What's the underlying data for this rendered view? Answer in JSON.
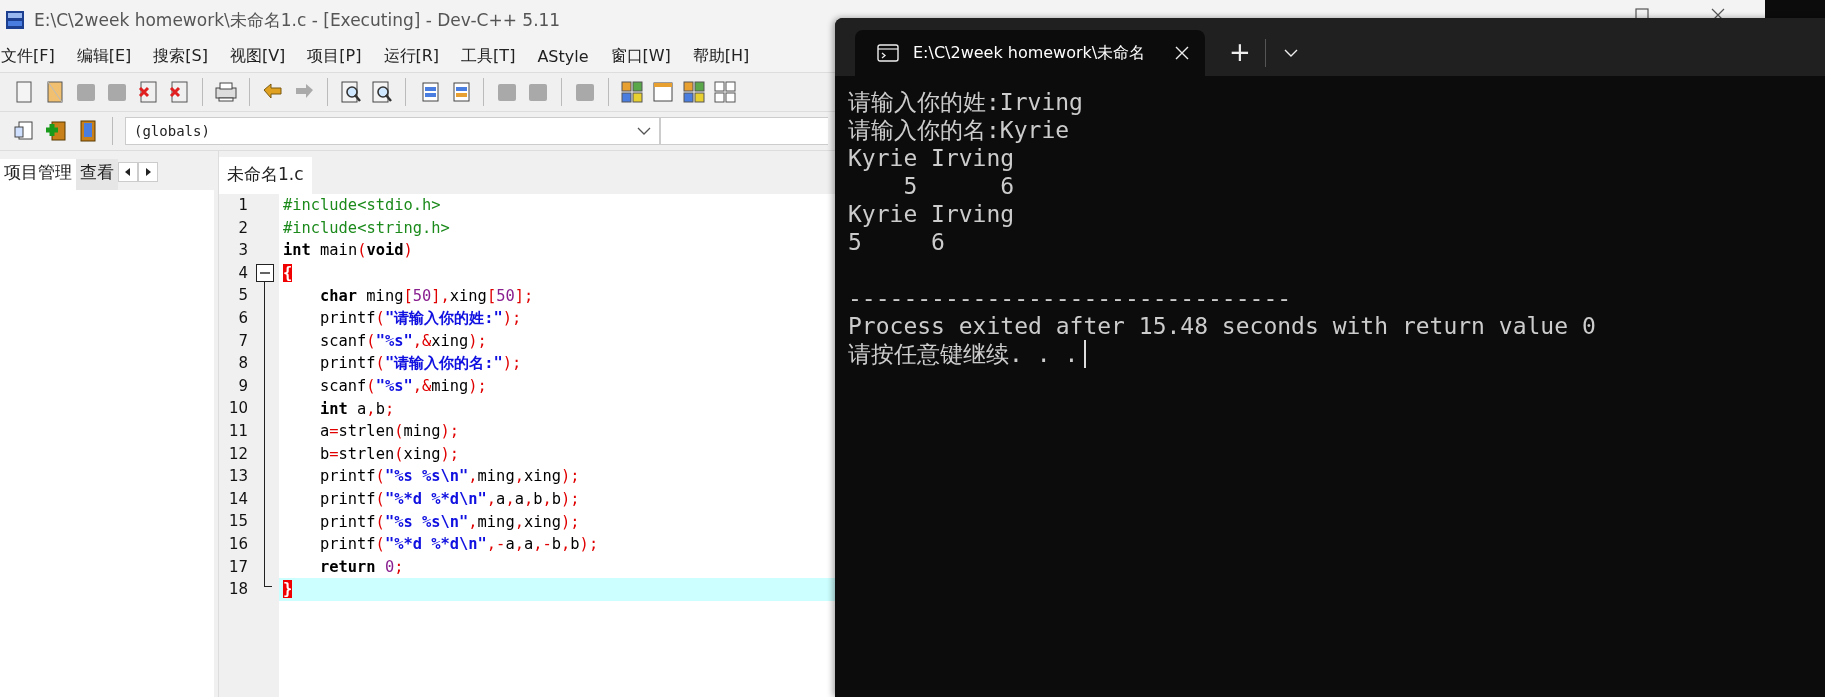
{
  "ide": {
    "title": "E:\\C\\2week homework\\未命名1.c - [Executing] - Dev-C++ 5.11",
    "menu": [
      "文件[F]",
      "编辑[E]",
      "搜索[S]",
      "视图[V]",
      "项目[P]",
      "运行[R]",
      "工具[T]",
      "AStyle",
      "窗口[W]",
      "帮助[H]"
    ],
    "scope_combo": {
      "value": "(globals)"
    },
    "left_tabs": [
      {
        "label": "项目管理",
        "selected": true
      },
      {
        "label": "查看",
        "selected": false
      }
    ],
    "editor_tabs": [
      {
        "label": "未命名1.c",
        "selected": true
      }
    ],
    "code": [
      {
        "number": "1",
        "indented": false,
        "current": false,
        "fold_start": false,
        "segments": [
          {
            "kind": "pre",
            "text": "#include<stdio.h>"
          }
        ]
      },
      {
        "number": "2",
        "indented": false,
        "current": false,
        "fold_start": false,
        "segments": [
          {
            "kind": "pre",
            "text": "#include<string.h>"
          }
        ]
      },
      {
        "number": "3",
        "indented": false,
        "current": false,
        "fold_start": false,
        "segments": [
          {
            "kind": "kw",
            "text": "int"
          },
          {
            "kind": "plain",
            "text": " main"
          },
          {
            "kind": "sym",
            "text": "("
          },
          {
            "kind": "kw",
            "text": "void"
          },
          {
            "kind": "sym",
            "text": ")"
          }
        ]
      },
      {
        "number": "4",
        "indented": false,
        "current": false,
        "fold_start": true,
        "segments": [
          {
            "kind": "brace",
            "text": "{"
          }
        ]
      },
      {
        "number": "5",
        "indented": true,
        "current": false,
        "fold_start": false,
        "segments": [
          {
            "kind": "kw",
            "text": "char"
          },
          {
            "kind": "plain",
            "text": " ming"
          },
          {
            "kind": "sym",
            "text": "["
          },
          {
            "kind": "num",
            "text": "50"
          },
          {
            "kind": "sym",
            "text": "],"
          },
          {
            "kind": "plain",
            "text": "xing"
          },
          {
            "kind": "sym",
            "text": "["
          },
          {
            "kind": "num",
            "text": "50"
          },
          {
            "kind": "sym",
            "text": "];"
          }
        ]
      },
      {
        "number": "6",
        "indented": true,
        "current": false,
        "fold_start": false,
        "segments": [
          {
            "kind": "plain",
            "text": "printf"
          },
          {
            "kind": "sym",
            "text": "("
          },
          {
            "kind": "str",
            "text": "\"请输入你的姓:\""
          },
          {
            "kind": "sym",
            "text": ");"
          }
        ]
      },
      {
        "number": "7",
        "indented": true,
        "current": false,
        "fold_start": false,
        "segments": [
          {
            "kind": "plain",
            "text": "scanf"
          },
          {
            "kind": "sym",
            "text": "("
          },
          {
            "kind": "str",
            "text": "\"%s\""
          },
          {
            "kind": "sym",
            "text": ",&"
          },
          {
            "kind": "plain",
            "text": "xing"
          },
          {
            "kind": "sym",
            "text": ");"
          }
        ]
      },
      {
        "number": "8",
        "indented": true,
        "current": false,
        "fold_start": false,
        "segments": [
          {
            "kind": "plain",
            "text": "printf"
          },
          {
            "kind": "sym",
            "text": "("
          },
          {
            "kind": "str",
            "text": "\"请输入你的名:\""
          },
          {
            "kind": "sym",
            "text": ");"
          }
        ]
      },
      {
        "number": "9",
        "indented": true,
        "current": false,
        "fold_start": false,
        "segments": [
          {
            "kind": "plain",
            "text": "scanf"
          },
          {
            "kind": "sym",
            "text": "("
          },
          {
            "kind": "str",
            "text": "\"%s\""
          },
          {
            "kind": "sym",
            "text": ",&"
          },
          {
            "kind": "plain",
            "text": "ming"
          },
          {
            "kind": "sym",
            "text": ");"
          }
        ]
      },
      {
        "number": "10",
        "indented": true,
        "current": false,
        "fold_start": false,
        "segments": [
          {
            "kind": "kw",
            "text": "int"
          },
          {
            "kind": "plain",
            "text": " a"
          },
          {
            "kind": "sym",
            "text": ","
          },
          {
            "kind": "plain",
            "text": "b"
          },
          {
            "kind": "sym",
            "text": ";"
          }
        ]
      },
      {
        "number": "11",
        "indented": true,
        "current": false,
        "fold_start": false,
        "segments": [
          {
            "kind": "plain",
            "text": "a"
          },
          {
            "kind": "sym",
            "text": "="
          },
          {
            "kind": "plain",
            "text": "strlen"
          },
          {
            "kind": "sym",
            "text": "("
          },
          {
            "kind": "plain",
            "text": "ming"
          },
          {
            "kind": "sym",
            "text": ");"
          }
        ]
      },
      {
        "number": "12",
        "indented": true,
        "current": false,
        "fold_start": false,
        "segments": [
          {
            "kind": "plain",
            "text": "b"
          },
          {
            "kind": "sym",
            "text": "="
          },
          {
            "kind": "plain",
            "text": "strlen"
          },
          {
            "kind": "sym",
            "text": "("
          },
          {
            "kind": "plain",
            "text": "xing"
          },
          {
            "kind": "sym",
            "text": ");"
          }
        ]
      },
      {
        "number": "13",
        "indented": true,
        "current": false,
        "fold_start": false,
        "segments": [
          {
            "kind": "plain",
            "text": "printf"
          },
          {
            "kind": "sym",
            "text": "("
          },
          {
            "kind": "str",
            "text": "\"%s %s\\n\""
          },
          {
            "kind": "sym",
            "text": ","
          },
          {
            "kind": "plain",
            "text": "ming"
          },
          {
            "kind": "sym",
            "text": ","
          },
          {
            "kind": "plain",
            "text": "xing"
          },
          {
            "kind": "sym",
            "text": ");"
          }
        ]
      },
      {
        "number": "14",
        "indented": true,
        "current": false,
        "fold_start": false,
        "segments": [
          {
            "kind": "plain",
            "text": "printf"
          },
          {
            "kind": "sym",
            "text": "("
          },
          {
            "kind": "str",
            "text": "\"%*d %*d\\n\""
          },
          {
            "kind": "sym",
            "text": ","
          },
          {
            "kind": "plain",
            "text": "a"
          },
          {
            "kind": "sym",
            "text": ","
          },
          {
            "kind": "plain",
            "text": "a"
          },
          {
            "kind": "sym",
            "text": ","
          },
          {
            "kind": "plain",
            "text": "b"
          },
          {
            "kind": "sym",
            "text": ","
          },
          {
            "kind": "plain",
            "text": "b"
          },
          {
            "kind": "sym",
            "text": ");"
          }
        ]
      },
      {
        "number": "15",
        "indented": true,
        "current": false,
        "fold_start": false,
        "segments": [
          {
            "kind": "plain",
            "text": "printf"
          },
          {
            "kind": "sym",
            "text": "("
          },
          {
            "kind": "str",
            "text": "\"%s %s\\n\""
          },
          {
            "kind": "sym",
            "text": ","
          },
          {
            "kind": "plain",
            "text": "ming"
          },
          {
            "kind": "sym",
            "text": ","
          },
          {
            "kind": "plain",
            "text": "xing"
          },
          {
            "kind": "sym",
            "text": ");"
          }
        ]
      },
      {
        "number": "16",
        "indented": true,
        "current": false,
        "fold_start": false,
        "segments": [
          {
            "kind": "plain",
            "text": "printf"
          },
          {
            "kind": "sym",
            "text": "("
          },
          {
            "kind": "str",
            "text": "\"%*d %*d\\n\""
          },
          {
            "kind": "sym",
            "text": ",-"
          },
          {
            "kind": "plain",
            "text": "a"
          },
          {
            "kind": "sym",
            "text": ","
          },
          {
            "kind": "plain",
            "text": "a"
          },
          {
            "kind": "sym",
            "text": ",-"
          },
          {
            "kind": "plain",
            "text": "b"
          },
          {
            "kind": "sym",
            "text": ","
          },
          {
            "kind": "plain",
            "text": "b"
          },
          {
            "kind": "sym",
            "text": ");"
          }
        ]
      },
      {
        "number": "17",
        "indented": true,
        "current": false,
        "fold_start": false,
        "segments": [
          {
            "kind": "kw",
            "text": "return "
          },
          {
            "kind": "num",
            "text": "0"
          },
          {
            "kind": "sym",
            "text": ";"
          }
        ]
      },
      {
        "number": "18",
        "indented": false,
        "current": true,
        "fold_start": false,
        "segments": [
          {
            "kind": "brace",
            "text": "}"
          }
        ]
      }
    ]
  },
  "terminal": {
    "tab": {
      "title": "E:\\C\\2week homework\\未命名",
      "selected": true
    },
    "new_tab": "+",
    "output": [
      "请输入你的姓:Irving",
      "请输入你的名:Kyrie",
      "Kyrie Irving",
      "    5      6",
      "Kyrie Irving",
      "5     6"
    ],
    "footer": [
      "--------------------------------",
      "Process exited after 15.48 seconds with return value 0",
      "请按任意键继续. . ."
    ]
  }
}
